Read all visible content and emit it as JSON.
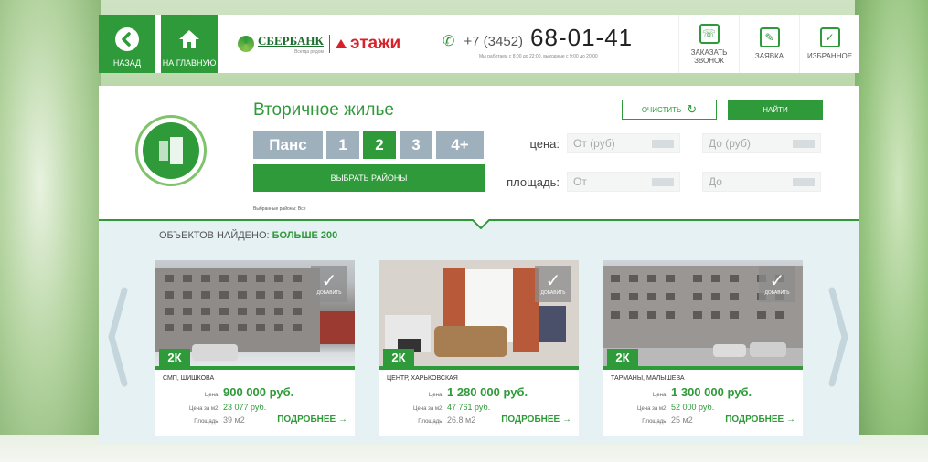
{
  "header": {
    "back_label": "НАЗАД",
    "home_label": "НА ГЛАВНУЮ",
    "sber_brand": "СБЕРБАНК",
    "sber_tagline": "Всегда рядом",
    "etazhi_brand": "этажи",
    "phone_code": "+7 (3452)",
    "phone_number": "68-01-41",
    "work_hours": "Мы работаем с 8:00 до 22:00, выходные с 9:00 до 20:00",
    "actions": [
      {
        "label": "ЗАКАЗАТЬ ЗВОНОК",
        "icon": "chat-phone-icon"
      },
      {
        "label": "ЗАЯВКА",
        "icon": "edit-icon"
      },
      {
        "label": "ИЗБРАННОЕ",
        "icon": "checkbox-icon"
      }
    ]
  },
  "search": {
    "title": "Вторичное жилье",
    "room_options": [
      "Панс",
      "1",
      "2",
      "3",
      "4+"
    ],
    "active_room": "2",
    "districts_button": "ВЫБРАТЬ РАЙОНЫ",
    "selected_districts": "Выбранные районы: Все",
    "clear_label": "ОЧИСТИТЬ",
    "find_label": "НАЙТИ",
    "price_label": "цена:",
    "price_from_placeholder": "От (руб)",
    "price_to_placeholder": "До (руб)",
    "area_label": "площадь:",
    "area_from_placeholder": "От",
    "area_to_placeholder": "До"
  },
  "results": {
    "found_label": "ОБЪЕКТОВ НАЙДЕНО:",
    "found_value": "БОЛЬШЕ 200",
    "add_label": "ДОБАВИТЬ",
    "price_caption": "Цена:",
    "price_m2_caption": "Цена за м2:",
    "area_caption": "Площадь:",
    "more_label": "ПОДРОБНЕЕ →",
    "cards": [
      {
        "rooms": "2К",
        "address": "СМП, ШИШКОВА",
        "price": "900 000 руб.",
        "price_m2": "23 077 руб.",
        "area": "39 м2"
      },
      {
        "rooms": "2К",
        "address": "ЦЕНТР, ХАРЬКОВСКАЯ",
        "price": "1 280 000 руб.",
        "price_m2": "47 761 руб.",
        "area": "26.8 м2"
      },
      {
        "rooms": "2К",
        "address": "ТАРМАНЫ, МАЛЫШЕВА",
        "price": "1 300 000 руб.",
        "price_m2": "52 000 руб.",
        "area": "25 м2"
      }
    ]
  },
  "colors": {
    "accent": "#2f9a3a",
    "brand_red": "#d6222a",
    "room_inactive": "#9fb0bd",
    "results_bg": "#e6f1f4"
  }
}
